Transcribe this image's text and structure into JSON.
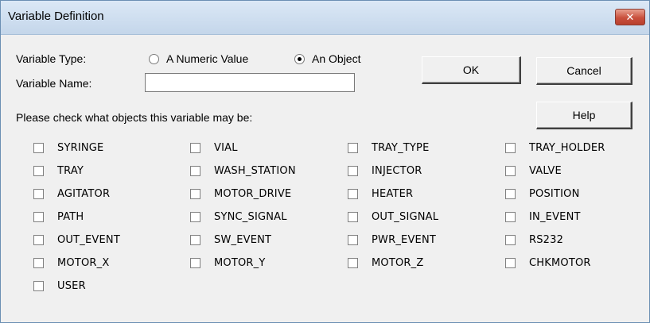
{
  "window": {
    "title": "Variable Definition",
    "close_label": "✕"
  },
  "form": {
    "type_label": "Variable Type:",
    "type_options": [
      {
        "label": "A Numeric Value",
        "selected": false
      },
      {
        "label": "An Object",
        "selected": true
      }
    ],
    "name_label": "Variable Name:",
    "name_value": "",
    "instruction": "Please check what objects this variable may be:"
  },
  "buttons": {
    "ok": "OK",
    "cancel": "Cancel",
    "help": "Help"
  },
  "objects": [
    [
      "SYRINGE",
      "VIAL",
      "TRAY_TYPE",
      "TRAY_HOLDER"
    ],
    [
      "TRAY",
      "WASH_STATION",
      "INJECTOR",
      "VALVE"
    ],
    [
      "AGITATOR",
      "MOTOR_DRIVE",
      "HEATER",
      "POSITION"
    ],
    [
      "PATH",
      "SYNC_SIGNAL",
      "OUT_SIGNAL",
      "IN_EVENT"
    ],
    [
      "OUT_EVENT",
      "SW_EVENT",
      "PWR_EVENT",
      "RS232"
    ],
    [
      "MOTOR_X",
      "MOTOR_Y",
      "MOTOR_Z",
      "CHKMOTOR"
    ],
    [
      "USER"
    ]
  ]
}
